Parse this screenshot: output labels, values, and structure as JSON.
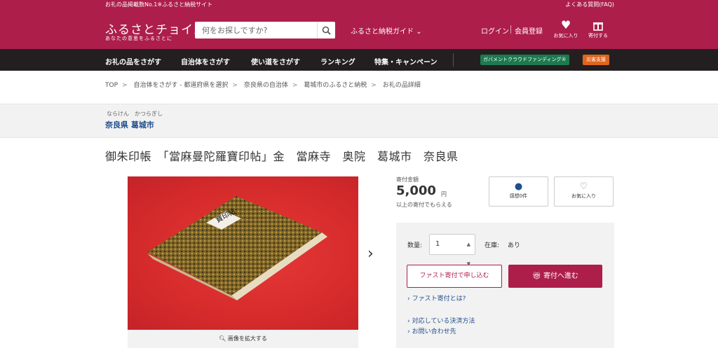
{
  "topbar": {
    "left": "お礼の品掲載数No.1※ふるさと納税サイト",
    "right": "よくある質問(FAQ)"
  },
  "header": {
    "logo": "ふるさとチョイス",
    "logo_sub": "あなたの意思をふるさとに",
    "search_placeholder": "何をお探しですか?",
    "guide": "ふるさと納税ガイド",
    "login": "ログイン",
    "register": "会員登録",
    "favorites": "お気に入り",
    "donate": "寄付する"
  },
  "nav": {
    "items": [
      "お礼の品をさがす",
      "自治体をさがす",
      "使い道をさがす",
      "ランキング",
      "特集・キャンペーン"
    ],
    "gov_crowdfunding": "ガバメントクラウドファンディング®",
    "disaster": "災害支援"
  },
  "breadcrumb": [
    "TOP",
    "自治体をさがす - 都道府県を選択",
    "奈良県の自治体",
    "葛城市のふるさと納税",
    "お礼の品詳細"
  ],
  "municipality": {
    "ruby": "ならけん　かつらぎし",
    "name": "奈良県 葛城市"
  },
  "product": {
    "title": "御朱印帳　「當麻曼陀羅寶印帖」金　當麻寺　奥院　葛城市　奈良県",
    "book_label": "寶印帖",
    "zoom": "画像を拡大する",
    "amount_label": "寄付金額",
    "amount": "5,000",
    "amount_unit": "円",
    "amount_note": "以上の寄付でもらえる",
    "thanks": "感想0件",
    "favorite": "お気に入り",
    "qty_label": "数量:",
    "qty": "1",
    "stock_label": "在庫:",
    "stock": "あり",
    "fast_btn": "ファスト寄付で申し込む",
    "donate_btn": "寄付へ進む",
    "links": [
      "ファスト寄付とは?",
      "対応している決済方法",
      "お問い合わせ先"
    ]
  },
  "colors": {
    "brand": "#ad1e4b",
    "nav": "#231f20",
    "link": "#1f4e8c",
    "gov": "#1d7a4f",
    "disaster": "#e0651e"
  }
}
